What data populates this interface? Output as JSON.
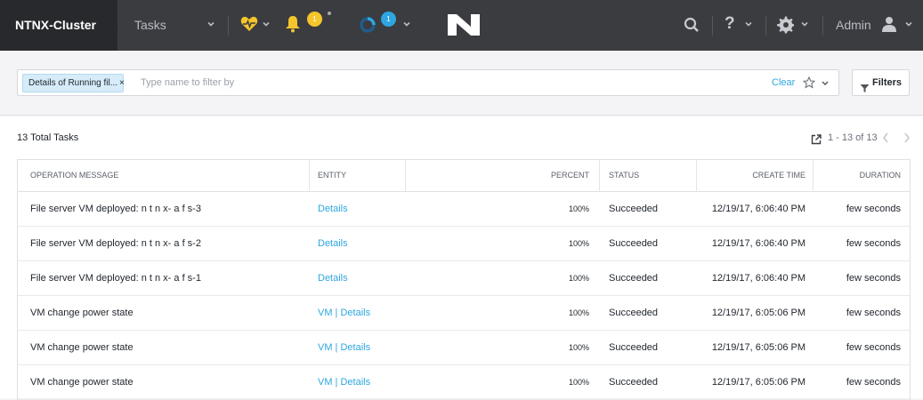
{
  "topbar": {
    "cluster_name": "NTNX-Cluster",
    "nav_label": "Tasks",
    "alerts_badge": "1",
    "tasks_badge": "1",
    "admin_label": "Admin",
    "help_glyph": "?"
  },
  "filter": {
    "chip_label": "Details of Running fil...",
    "chip_close": "×",
    "placeholder": "Type name to filter by",
    "clear_label": "Clear",
    "filters_button": "Filters"
  },
  "summary": {
    "total_label": "13 Total Tasks",
    "pagination": "1 - 13 of 13"
  },
  "table": {
    "headers": {
      "operation": "OPERATION MESSAGE",
      "entity": "ENTITY",
      "percent": "PERCENT",
      "status": "STATUS",
      "create_time": "CREATE TIME",
      "duration": "DURATION"
    },
    "rows": [
      {
        "operation": "File server VM deployed: n t n x- a f s-3",
        "entity": "Details",
        "percent": "100%",
        "status": "Succeeded",
        "create_time": "12/19/17, 6:06:40 PM",
        "duration": "few seconds"
      },
      {
        "operation": "File server VM deployed: n t n x- a f s-2",
        "entity": "Details",
        "percent": "100%",
        "status": "Succeeded",
        "create_time": "12/19/17, 6:06:40 PM",
        "duration": "few seconds"
      },
      {
        "operation": "File server VM deployed: n t n x- a f s-1",
        "entity": "Details",
        "percent": "100%",
        "status": "Succeeded",
        "create_time": "12/19/17, 6:06:40 PM",
        "duration": "few seconds"
      },
      {
        "operation": "VM change power state",
        "entity": "VM | Details",
        "percent": "100%",
        "status": "Succeeded",
        "create_time": "12/19/17, 6:05:06 PM",
        "duration": "few seconds"
      },
      {
        "operation": "VM change power state",
        "entity": "VM | Details",
        "percent": "100%",
        "status": "Succeeded",
        "create_time": "12/19/17, 6:05:06 PM",
        "duration": "few seconds"
      },
      {
        "operation": "VM change power state",
        "entity": "VM | Details",
        "percent": "100%",
        "status": "Succeeded",
        "create_time": "12/19/17, 6:05:06 PM",
        "duration": "few seconds"
      }
    ]
  },
  "colors": {
    "topbar_bg": "#3b3c40",
    "cluster_bg": "#28292c",
    "link": "#2ea6e0",
    "health_yellow": "#f5c52c",
    "chip_bg": "#d6ecf8"
  }
}
